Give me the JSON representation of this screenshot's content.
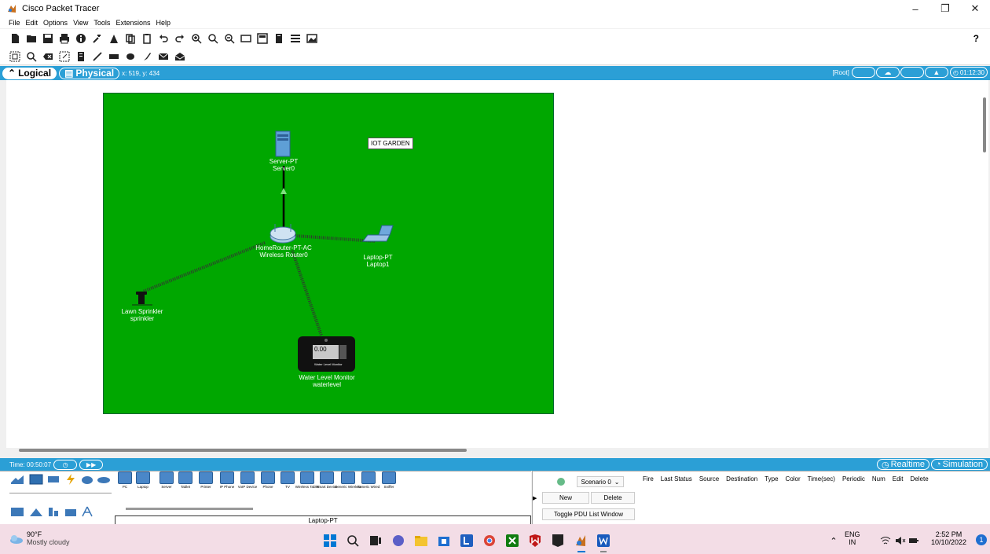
{
  "window": {
    "title": "Cisco Packet Tracer",
    "minimize": "–",
    "restore": "❐",
    "close": "✕"
  },
  "menu": [
    "File",
    "Edit",
    "Options",
    "View",
    "Tools",
    "Extensions",
    "Help"
  ],
  "toolbar": {
    "help": "?"
  },
  "view": {
    "logical_label": "Logical",
    "physical_label": "Physical",
    "coords": "x: 519, y: 434",
    "root": "[Root]",
    "clock": "01:12:30"
  },
  "workspace": {
    "background": "#00a700",
    "note": "IOT GARDEN",
    "devices": [
      {
        "type": "Server-PT",
        "name": "Server0"
      },
      {
        "type": "HomeRouter-PT-AC",
        "name": "Wireless Router0"
      },
      {
        "type": "Laptop-PT",
        "name": "Laptop1"
      },
      {
        "type": "Lawn Sprinkler",
        "name": "sprinkler"
      },
      {
        "type": "Water Level Monitor",
        "name": "waterlevel",
        "display": "0.00",
        "panel_label": "Water Level Monitor"
      }
    ]
  },
  "timebar": {
    "time": "Time: 00:50:07",
    "realtime": "Realtime",
    "simulation": "Simulation"
  },
  "device_types": [
    "PC",
    "Laptop",
    "Server",
    "Tablet",
    "Printer",
    "IP Phone",
    "VoIP Device",
    "Phone",
    "TV",
    "Wireless Tablet",
    "Smart Device",
    "Generic Wireless",
    "Generic Wired",
    "Sniffer"
  ],
  "selected_device": "Laptop-PT",
  "pdu": {
    "scenario": "Scenario 0",
    "new": "New",
    "delete": "Delete",
    "toggle": "Toggle PDU List Window",
    "columns": [
      "Fire",
      "Last Status",
      "Source",
      "Destination",
      "Type",
      "Color",
      "Time(sec)",
      "Periodic",
      "Num",
      "Edit",
      "Delete"
    ]
  },
  "taskbar": {
    "temp": "90°F",
    "weather": "Mostly cloudy",
    "lang": "ENG",
    "region": "IN",
    "time": "2:52 PM",
    "date": "10/10/2022",
    "badge": "1"
  },
  "colors": {
    "accent": "#2b9fd6",
    "garden": "#00a700",
    "taskbar": "#f3dde6"
  }
}
